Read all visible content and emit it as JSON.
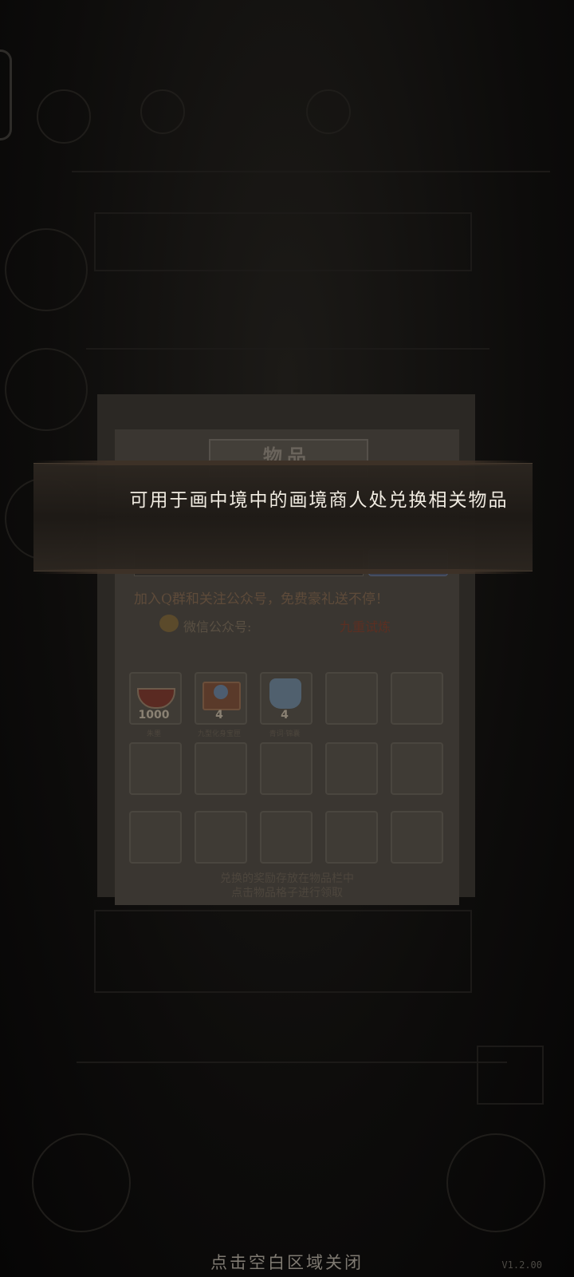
{
  "tooltip": {
    "text": "可用于画中境中的画境商人处兑换相关物品"
  },
  "panel": {
    "title": "物品",
    "promo_text": "加入Q群和关注公众号，免费豪礼送不停！",
    "wechat_label": "微信公众号:",
    "wechat_value": "九重试炼",
    "footer_line1": "兑换的奖励存放在物品栏中",
    "footer_line2": "点击物品格子进行领取"
  },
  "inventory": {
    "items": [
      {
        "name": "朱墨",
        "count": "1000",
        "icon": "ink-bowl-icon"
      },
      {
        "name": "九型化身宝匣",
        "count": "4",
        "icon": "treasure-box-icon"
      },
      {
        "name": "青词·锦囊",
        "count": "4",
        "icon": "cloth-pouch-icon"
      }
    ]
  },
  "close_hint": "点击空白区域关闭",
  "version": "V1.2.00"
}
